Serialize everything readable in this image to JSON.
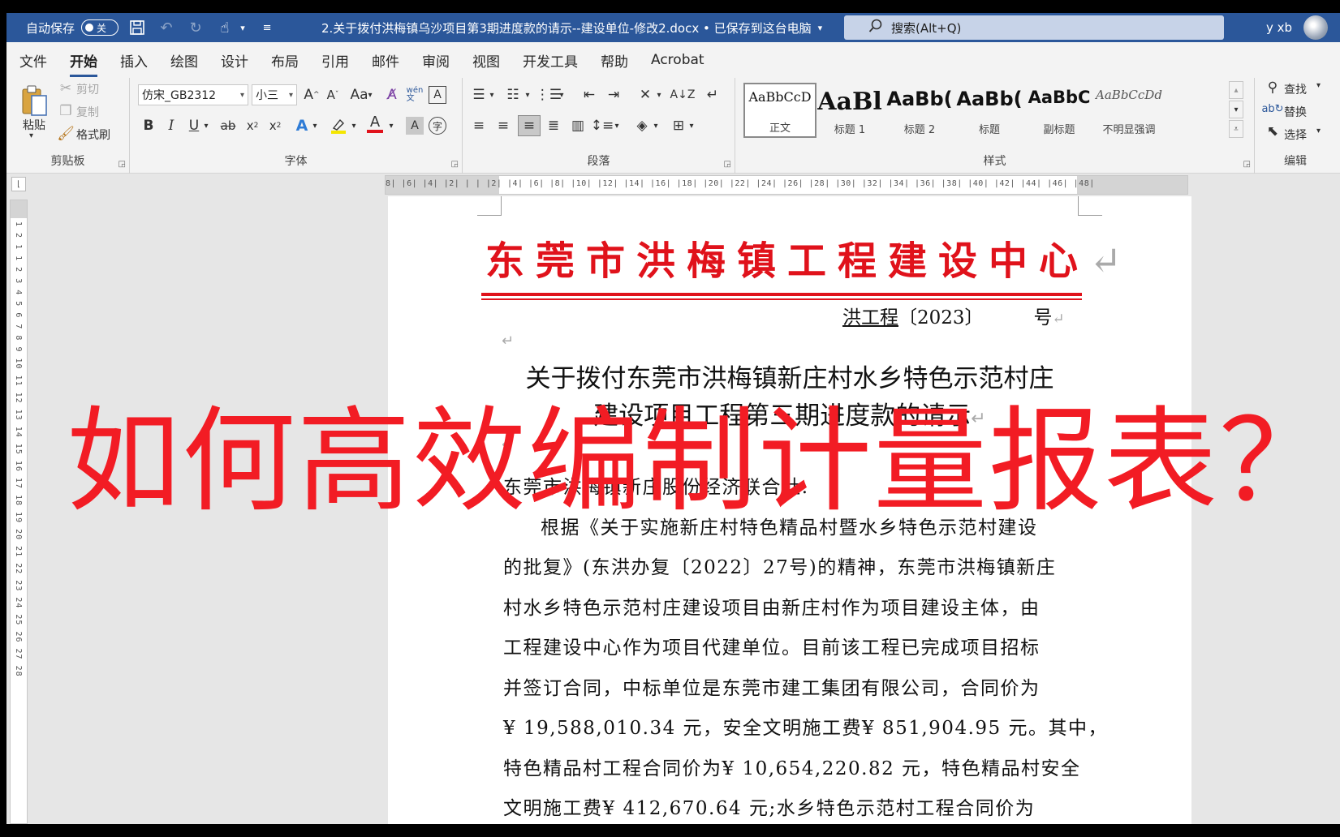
{
  "titlebar": {
    "autosave_label": "自动保存",
    "autosave_state": "关",
    "document_title": "2.关于拨付洪梅镇乌沙项目第3期进度款的请示--建设单位-修改2.docx • 已保存到这台电脑",
    "search_placeholder": "搜索(Alt+Q)",
    "user_name": "y xb",
    "icons": [
      "save-icon",
      "undo-icon",
      "redo-icon",
      "touch-mode-icon",
      "customize-icon"
    ]
  },
  "menu": {
    "tabs": [
      "文件",
      "开始",
      "插入",
      "绘图",
      "设计",
      "布局",
      "引用",
      "邮件",
      "审阅",
      "视图",
      "开发工具",
      "帮助",
      "Acrobat"
    ],
    "active": "开始"
  },
  "ribbon": {
    "clipboard": {
      "label": "剪贴板",
      "paste": "粘贴",
      "cut": "剪切",
      "copy": "复制",
      "format_painter": "格式刷"
    },
    "font": {
      "label": "字体",
      "font_name": "仿宋_GB2312",
      "font_size": "小三"
    },
    "paragraph": {
      "label": "段落"
    },
    "styles": {
      "label": "样式",
      "items": [
        {
          "sample": "AaBbCcD",
          "name": "正文"
        },
        {
          "sample": "AaBl",
          "name": "标题 1"
        },
        {
          "sample": "AaBb(",
          "name": "标题 2"
        },
        {
          "sample": "AaBb(",
          "name": "标题"
        },
        {
          "sample": "AaBbC",
          "name": "副标题"
        },
        {
          "sample": "AaBbCcDd",
          "name": "不明显强调"
        }
      ]
    },
    "editing": {
      "label": "编辑",
      "find": "查找",
      "replace": "替换",
      "select": "选择"
    }
  },
  "ruler": {
    "horizontal": "8| |6| |4| |2| |  | |2| |4| |6| |8| |10| |12| |14| |16| |18| |20| |22| |24| |26| |28| |30| |32| |34| |36| |38| |40| |42| |44| |46| |48|",
    "vertical": "1 2 1 1 2 3 4 5 6 7 8 9 10 11 12 13 14 15 16 17 18 19 20 21 22 23 24 25 26 27 28"
  },
  "document": {
    "org_name": "东莞市洪梅镇工程建设中心",
    "doc_number_prefix": "洪工程",
    "doc_number_year": "〔2023〕",
    "doc_number_suffix": "号",
    "title_line1": "关于拨付东莞市洪梅镇新庄村水乡特色示范村庄",
    "title_line2": "建设项目工程第三期进度款的请示",
    "addressee": "东莞市洪梅镇新庄股份经济联合社:",
    "body_lines": [
      "根据《关于实施新庄村特色精品村暨水乡特色示范村建设",
      "的批复》(东洪办复〔2022〕27号)的精神，东莞市洪梅镇新庄",
      "村水乡特色示范村庄建设项目由新庄村作为项目建设主体，由",
      "工程建设中心作为项目代建单位。目前该工程已完成项目招标",
      "并签订合同，中标单位是东莞市建工集团有限公司，合同价为",
      "¥ 19,588,010.34 元，安全文明施工费¥ 851,904.95 元。其中，",
      "特色精品村工程合同价为¥ 10,654,220.82 元，特色精品村安全",
      "文明施工费¥ 412,670.64 元;水乡特色示范村工程合同价为"
    ]
  },
  "overlay": {
    "headline": "如何高效编制计量报表？",
    "color": "#f21c24"
  },
  "colors": {
    "title_bar": "#2b579a",
    "doc_red": "#e0121b"
  }
}
